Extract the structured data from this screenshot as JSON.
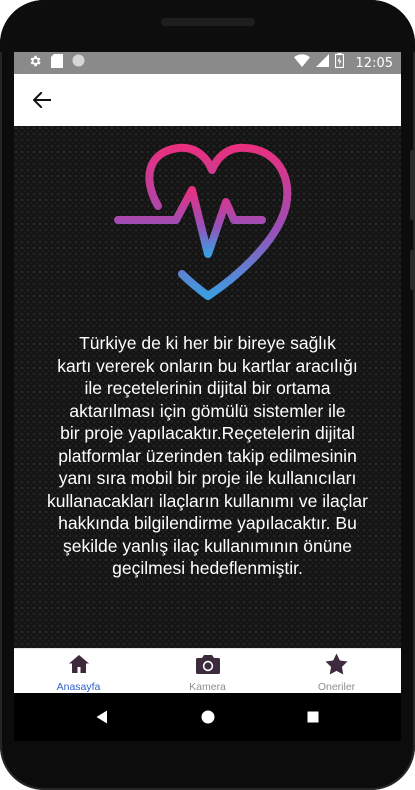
{
  "status_bar": {
    "time": "12:05",
    "icons": [
      "gear-icon",
      "sd-card-icon",
      "circle-icon",
      "wifi-icon",
      "signal-icon",
      "battery-icon"
    ]
  },
  "app_bar": {
    "back_icon": "arrow-left-icon"
  },
  "content": {
    "logo_icon": "heart-pulse-icon",
    "description": "Türkiye de ki her bir bireye sağlık\nkartı vererek onların bu kartlar aracılığı\nile reçetelerinin dijital bir ortama\naktarılması için gömülü sistemler ile\nbir proje yapılacaktır.Reçetelerin dijital\nplatformlar üzerinden takip edilmesinin\nyanı sıra mobil bir proje ile kullanıcıları\nkullanacakları ilaçların kullanımı ve ilaçlar\nhakkında bilgilendirme yapılacaktır.  Bu\nşekilde yanlış ilaç kullanımının önüne\ngeçilmesi hedeflenmiştir."
  },
  "bottom_nav": {
    "items": [
      {
        "label": "Anasayfa",
        "icon": "home-icon",
        "active": true
      },
      {
        "label": "Kamera",
        "icon": "camera-icon",
        "active": false
      },
      {
        "label": "Oneriler",
        "icon": "star-icon",
        "active": false
      }
    ]
  },
  "colors": {
    "active_nav": "#2f5fc8",
    "inactive_nav": "#8e8e8e",
    "icon_dark": "#3d2a3c",
    "heart_gradient_top": "#e8307f",
    "heart_gradient_bottom": "#3b9ee0"
  }
}
